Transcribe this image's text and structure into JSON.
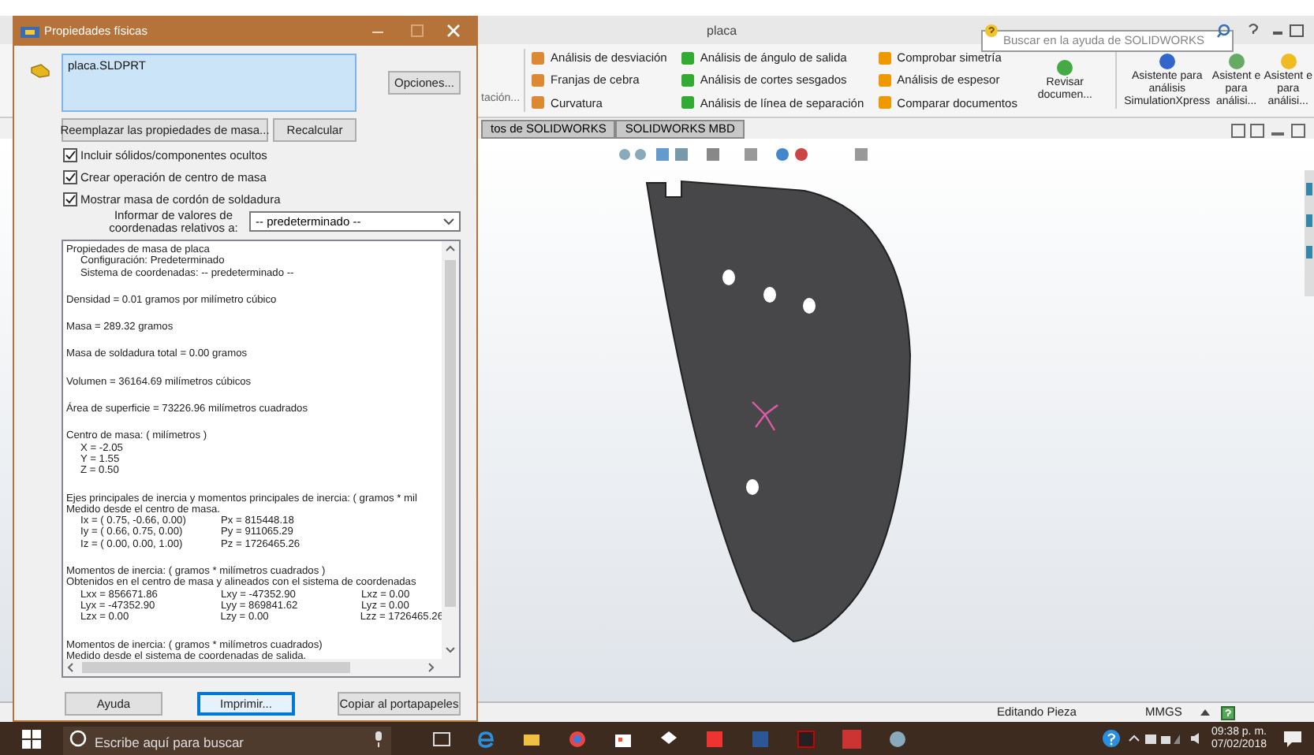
{
  "dialog": {
    "title": "Propiedades físicas",
    "files": [
      {
        "label": "placa.SLDPRT",
        "selected": true
      }
    ],
    "options_button": "Opciones...",
    "replace_button": "Reemplazar las propiedades de masa...",
    "recalc_button": "Recalcular",
    "checkboxes": [
      {
        "label": "Incluir sólidos/componentes ocultos",
        "checked": true
      },
      {
        "label": "Crear operación de centro de masa",
        "checked": true
      },
      {
        "label": "Mostrar masa de cordón de soldadura",
        "checked": true
      }
    ],
    "coord_label": "Informar de valores de coordenadas relativos a:",
    "coord_value": "-- predeterminado --",
    "results": [
      {
        "lines": [
          "Propiedades de masa de placa"
        ],
        "children": [
          {
            "cells": [
              "Configuración:  Predeterminado"
            ]
          },
          {
            "cells": [
              "Sistema de coordenadas:  -- predeterminado --"
            ]
          }
        ]
      },
      {
        "lines": [
          "Densidad = 0.01 gramos por milímetro cúbico"
        ]
      },
      {
        "lines": [
          "Masa = 289.32 gramos"
        ]
      },
      {
        "lines": [
          "Masa de soldadura total = 0.00 gramos"
        ]
      },
      {
        "lines": [
          "Volumen = 36164.69 milímetros cúbicos"
        ]
      },
      {
        "lines": [
          "Área de superficie = 73226.96  milímetros cuadrados"
        ]
      },
      {
        "lines": [
          "Centro de masa: ( milímetros )"
        ],
        "children": [
          {
            "cells": [
              "X = -2.05"
            ]
          },
          {
            "cells": [
              "Y = 1.55"
            ]
          },
          {
            "cells": [
              "Z = 0.50"
            ]
          }
        ]
      },
      {
        "lines": [
          "Ejes principales de inercia y momentos principales de inercia: ( gramos *  mil",
          "Medido desde el centro de masa."
        ],
        "children": [
          {
            "cells": [
              "Ix = ( 0.75, -0.66,  0.00)",
              "Px = 815448.18"
            ]
          },
          {
            "cells": [
              "Iy = ( 0.66,  0.75,  0.00)",
              "Py = 911065.29"
            ]
          },
          {
            "cells": [
              "Iz = ( 0.00,  0.00,  1.00)",
              "Pz = 1726465.26"
            ]
          }
        ]
      },
      {
        "lines": [
          "Momentos de inercia: ( gramos *  milímetros cuadrados )",
          "Obtenidos en el centro de masa y alineados con el sistema de coordenadas"
        ],
        "children": [
          {
            "cells": [
              "Lxx = 856671.86",
              "Lxy = -47352.90",
              "Lxz = 0.00"
            ]
          },
          {
            "cells": [
              "Lyx = -47352.90",
              "Lyy = 869841.62",
              "Lyz = 0.00"
            ]
          },
          {
            "cells": [
              "Lzx = 0.00",
              "Lzy = 0.00",
              "Lzz = 1726465.26"
            ]
          }
        ]
      },
      {
        "lines": [
          "Momentos de inercia: ( gramos *  milímetros cuadrados)",
          "Medido desde el sistema de coordenadas de salida."
        ]
      }
    ],
    "footer_buttons": [
      {
        "label": "Ayuda",
        "selected": false
      },
      {
        "label": "Imprimir...",
        "selected": true
      },
      {
        "label": "Copiar al portapapeles",
        "selected": false
      }
    ]
  },
  "app": {
    "title": "placa",
    "search_placeholder": "Buscar en la ayuda de SOLIDWORKS",
    "ribbon_cut_label": "tación...",
    "ribbon_groups": [
      [
        "Análisis de desviación",
        "Franjas de cebra",
        "Curvatura"
      ],
      [
        "Análisis de ángulo de salida",
        "Análisis de cortes sesgados",
        "Análisis de línea de separación"
      ],
      [
        "Comprobar simetría",
        "Análisis de espesor",
        "Comparar documentos"
      ]
    ],
    "ribbon_large": [
      "Revisar documen...",
      "Asistente para análisis SimulationXpress",
      "Asistent e para análisi...",
      "Asistent e para análisi..."
    ],
    "tabs": [
      {
        "label": "tos de SOLIDWORKS",
        "selected": false
      },
      {
        "label": "SOLIDWORKS MBD",
        "selected": false
      }
    ],
    "status_bar": {
      "state": "Editando Pieza",
      "units": "MMGS"
    }
  },
  "taskbar": {
    "search_placeholder": "Escribe aquí para buscar",
    "time": "09:38 p. m.",
    "date": "07/02/2018"
  }
}
